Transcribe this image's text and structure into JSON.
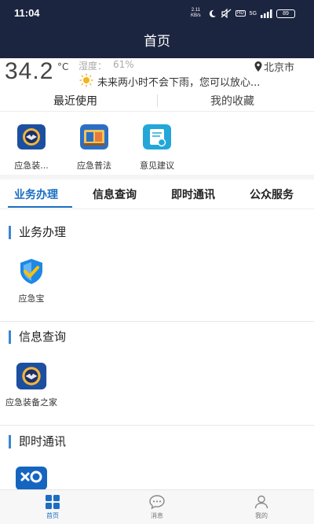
{
  "statusbar": {
    "time": "11:04",
    "netspeed_value": "2.11",
    "netspeed_unit": "KB/s",
    "hd_badge": "HD",
    "network": "5G",
    "battery": "89"
  },
  "header": {
    "title": "首页"
  },
  "weather": {
    "temperature": "34.2",
    "temperature_unit": "°C",
    "humidity_label": "湿度：",
    "humidity_value": "61%",
    "location": "北京市",
    "forecast": "未来两小时不会下雨，您可以放心..."
  },
  "top_tabs": [
    {
      "label": "最近使用"
    },
    {
      "label": "我的收藏"
    }
  ],
  "recent_apps": [
    {
      "label": "应急装...",
      "icon": "emergency-badge-icon"
    },
    {
      "label": "应急普法",
      "icon": "law-book-icon"
    },
    {
      "label": "意见建议",
      "icon": "feedback-form-icon"
    }
  ],
  "category_tabs": [
    {
      "label": "业务办理"
    },
    {
      "label": "信息查询"
    },
    {
      "label": "即时通讯"
    },
    {
      "label": "公众服务"
    }
  ],
  "sections": [
    {
      "title": "业务办理",
      "apps": [
        {
          "label": "应急宝",
          "icon": "shield-check-icon"
        }
      ]
    },
    {
      "title": "信息查询",
      "apps": [
        {
          "label": "应急装备之家",
          "icon": "emergency-badge-icon"
        }
      ]
    },
    {
      "title": "即时通讯",
      "apps": [
        {
          "label": "",
          "icon": "chat-link-icon"
        }
      ]
    }
  ],
  "bottom_nav": [
    {
      "label": "首页",
      "icon": "grid-home-icon",
      "active": true
    },
    {
      "label": "消息",
      "icon": "message-bubble-icon",
      "active": false
    },
    {
      "label": "我的",
      "icon": "user-profile-icon",
      "active": false
    }
  ],
  "colors": {
    "header_bg": "#1c2540",
    "accent": "#1b6ec2",
    "section_marker": "#3a85d6"
  }
}
